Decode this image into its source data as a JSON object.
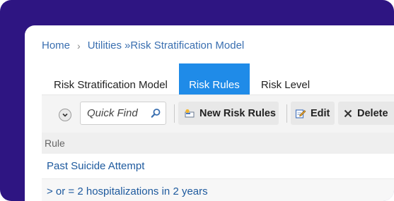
{
  "breadcrumb": {
    "home": "Home",
    "utilities": "Utilities",
    "separator_glyph": "»",
    "current": "Risk Stratification Model"
  },
  "tabs": [
    {
      "label": "Risk Stratification Model",
      "active": false
    },
    {
      "label": "Risk Rules",
      "active": true
    },
    {
      "label": "Risk Level",
      "active": false
    }
  ],
  "toolbar": {
    "search_placeholder": "Quick Find",
    "new_label": "New Risk Rules",
    "edit_label": "Edit",
    "delete_label": "Delete"
  },
  "grid": {
    "column_header": "Rule",
    "rows": [
      "Past Suicide Attempt",
      "> or = 2 hospitalizations in 2 years"
    ]
  },
  "colors": {
    "frame": "#2e1582",
    "active_tab": "#1f8be8",
    "link": "#3a6fb0",
    "row_text": "#1e5a9e"
  },
  "icons": [
    "chevron-right-icon",
    "chevron-down-icon",
    "search-icon",
    "new-record-icon",
    "edit-icon",
    "delete-icon"
  ]
}
